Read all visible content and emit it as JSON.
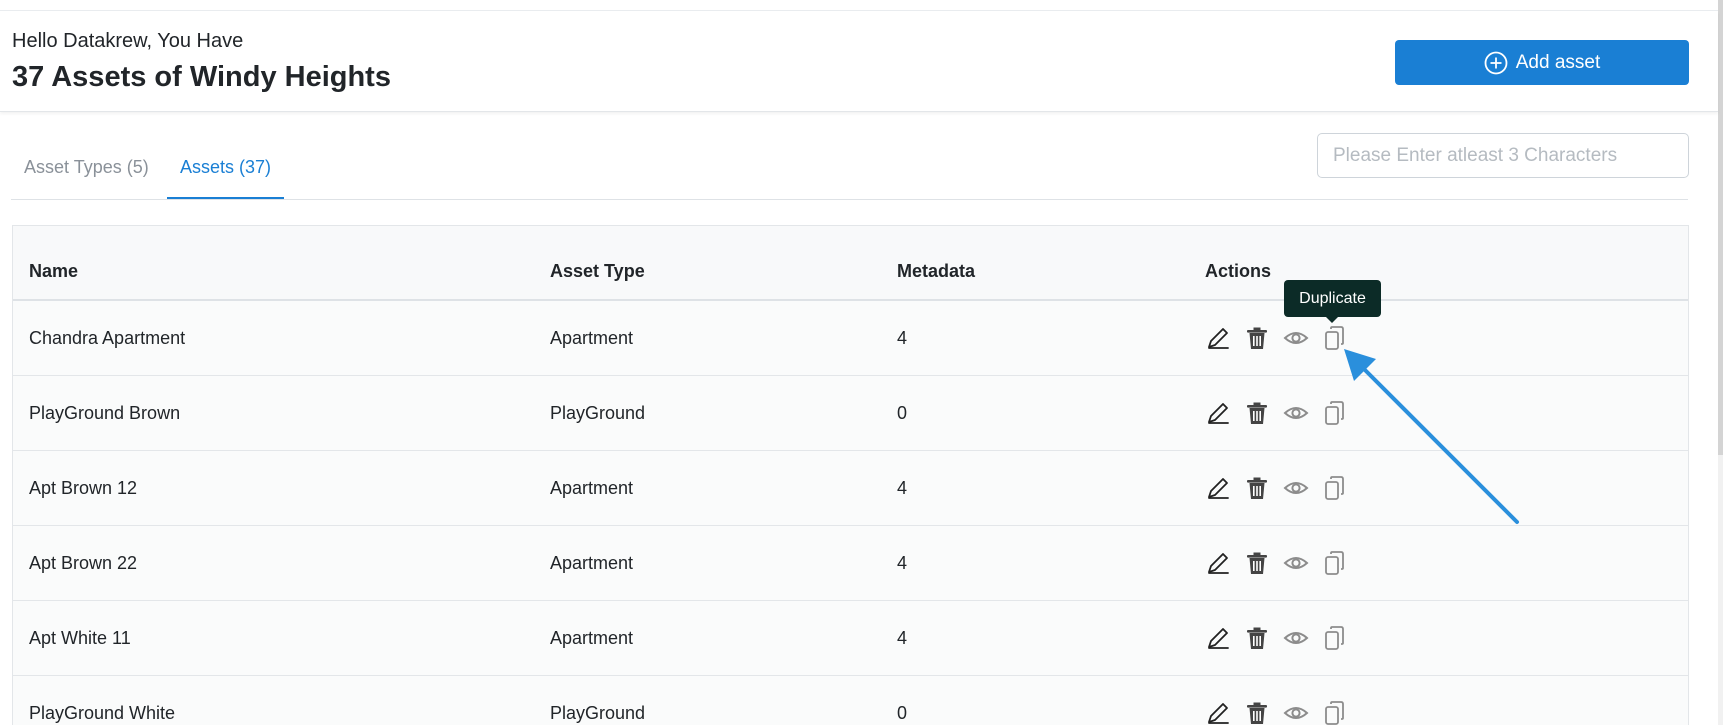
{
  "header": {
    "greeting": "Hello Datakrew, You Have",
    "title": "37 Assets of Windy Heights",
    "add_button_label": "Add asset"
  },
  "tabs": [
    {
      "label": "Asset Types (5)",
      "active": false
    },
    {
      "label": "Assets (37)",
      "active": true
    }
  ],
  "search": {
    "placeholder": "Please Enter atleast 3 Characters",
    "value": ""
  },
  "table": {
    "columns": [
      "Name",
      "Asset Type",
      "Metadata",
      "Actions"
    ],
    "rows": [
      {
        "name": "Chandra Apartment",
        "type": "Apartment",
        "metadata": "4"
      },
      {
        "name": "PlayGround Brown",
        "type": "PlayGround",
        "metadata": "0"
      },
      {
        "name": "Apt Brown 12",
        "type": "Apartment",
        "metadata": "4"
      },
      {
        "name": "Apt Brown 22",
        "type": "Apartment",
        "metadata": "4"
      },
      {
        "name": "Apt White 11",
        "type": "Apartment",
        "metadata": "4"
      },
      {
        "name": "PlayGround White",
        "type": "PlayGround",
        "metadata": "0"
      }
    ],
    "action_icons": [
      "edit-icon",
      "delete-icon",
      "view-icon",
      "duplicate-icon"
    ]
  },
  "tooltip": {
    "label": "Duplicate"
  },
  "colors": {
    "accent": "#1a7fd4",
    "tooltip_bg": "#0c2b27",
    "annotation_arrow": "#2a8fdc",
    "icon_dark": "#444444",
    "icon_light": "#8c8c8c"
  }
}
